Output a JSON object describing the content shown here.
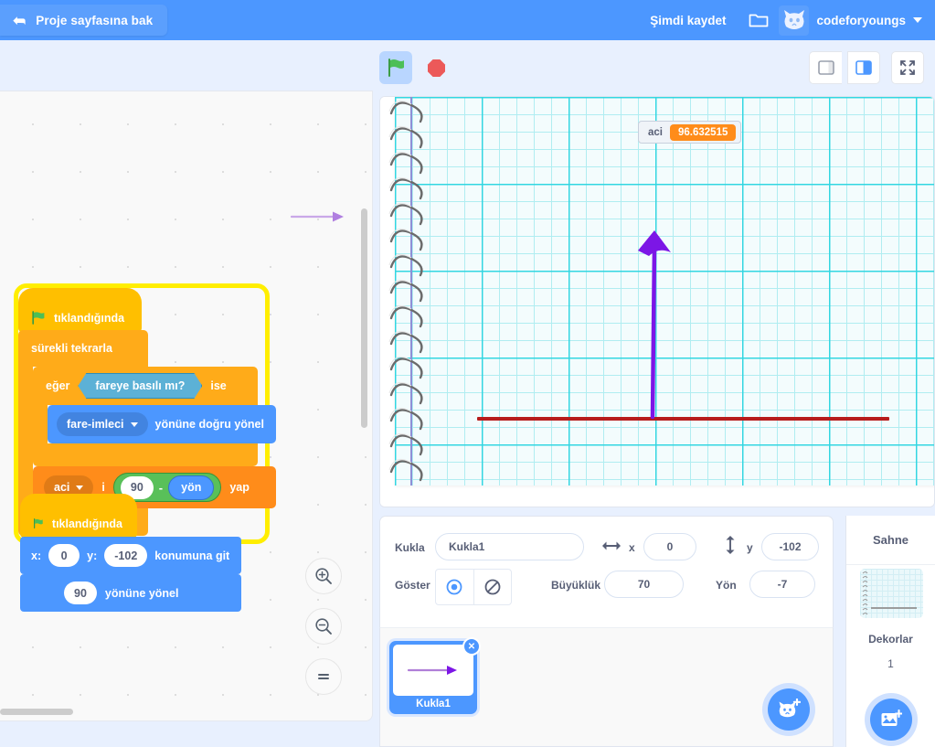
{
  "menubar": {
    "see_project_label": "Proje sayfasına bak",
    "see_project_icon": "back-arrow-icon",
    "save_now_label": "Şimdi kaydet",
    "folder_icon": "folder-icon",
    "account_name": "codeforyoungs",
    "avatar_icon": "cat-avatar-icon",
    "caret_icon": "chevron-down-icon",
    "bar_color": "#4c97ff"
  },
  "controls": {
    "green_flag_icon": "green-flag-icon",
    "stop_icon": "stop-sign-icon",
    "layout_small_icon": "small-stage-layout-icon",
    "layout_normal_icon": "normal-stage-layout-icon",
    "layout_full_icon": "fullscreen-icon",
    "green_flag_color": "#4cbf56",
    "stop_color": "#ec5959"
  },
  "workspace": {
    "zoom_in_icon": "zoom-in-icon",
    "zoom_out_icon": "zoom-out-icon",
    "zoom_reset_icon": "zoom-reset-icon",
    "ghost_sprite_icon": "arrow-sprite-ghost-icon"
  },
  "scripts": [
    {
      "id": "script-1",
      "glowing": true,
      "hat": {
        "label": "tıklandığında",
        "icon": "green-flag-icon"
      },
      "forever": {
        "label": "sürekli tekrarla",
        "loop_icon": "loop-arrow-icon"
      },
      "if_block": {
        "prefix": "eğer",
        "suffix": "ise",
        "condition": "fareye basılı mı?"
      },
      "point_towards": {
        "dropdown": "fare-imleci",
        "label": "yönüne doğru yönel"
      },
      "set_var": {
        "variable": "aci",
        "middle": "i",
        "suffix": "yap",
        "operator": "-",
        "left_operand": "90",
        "right_operand": "yön"
      }
    },
    {
      "id": "script-2",
      "glowing": false,
      "hat": {
        "label": "tıklandığında",
        "icon": "green-flag-icon"
      },
      "goto": {
        "x_label": "x:",
        "x_value": "0",
        "y_label": "y:",
        "y_value": "-102",
        "suffix": "konumuna git"
      },
      "point_in_direction": {
        "value": "90",
        "label": "yönüne yönel"
      }
    }
  ],
  "stage": {
    "monitor": {
      "name": "aci",
      "value": "96.632515",
      "value_color": "#ff8c1a"
    },
    "backdrop": "notebook-graph-paper",
    "pen_line_color": "#b71c1c",
    "sprite_color": "#7c16e6"
  },
  "sprite_info": {
    "name_label": "Kukla",
    "name_value": "Kukla1",
    "x_label": "x",
    "x_value": "0",
    "y_label": "y",
    "y_value": "-102",
    "show_label": "Göster",
    "show_on_icon": "eye-visible-icon",
    "show_off_icon": "eye-hidden-icon",
    "size_label": "Büyüklük",
    "size_value": "70",
    "direction_label": "Yön",
    "direction_value": "-7",
    "x_arrow_icon": "horizontal-arrows-icon",
    "y_arrow_icon": "vertical-arrows-icon"
  },
  "sprite_list": {
    "sprites": [
      {
        "name": "Kukla1",
        "selected": true,
        "delete_icon": "delete-x-icon"
      }
    ],
    "add_sprite_icon": "add-sprite-cat-icon"
  },
  "stage_panel": {
    "title": "Sahne",
    "backdrops_label": "Dekorlar",
    "backdrops_count": "1",
    "add_backdrop_icon": "add-backdrop-image-icon"
  }
}
